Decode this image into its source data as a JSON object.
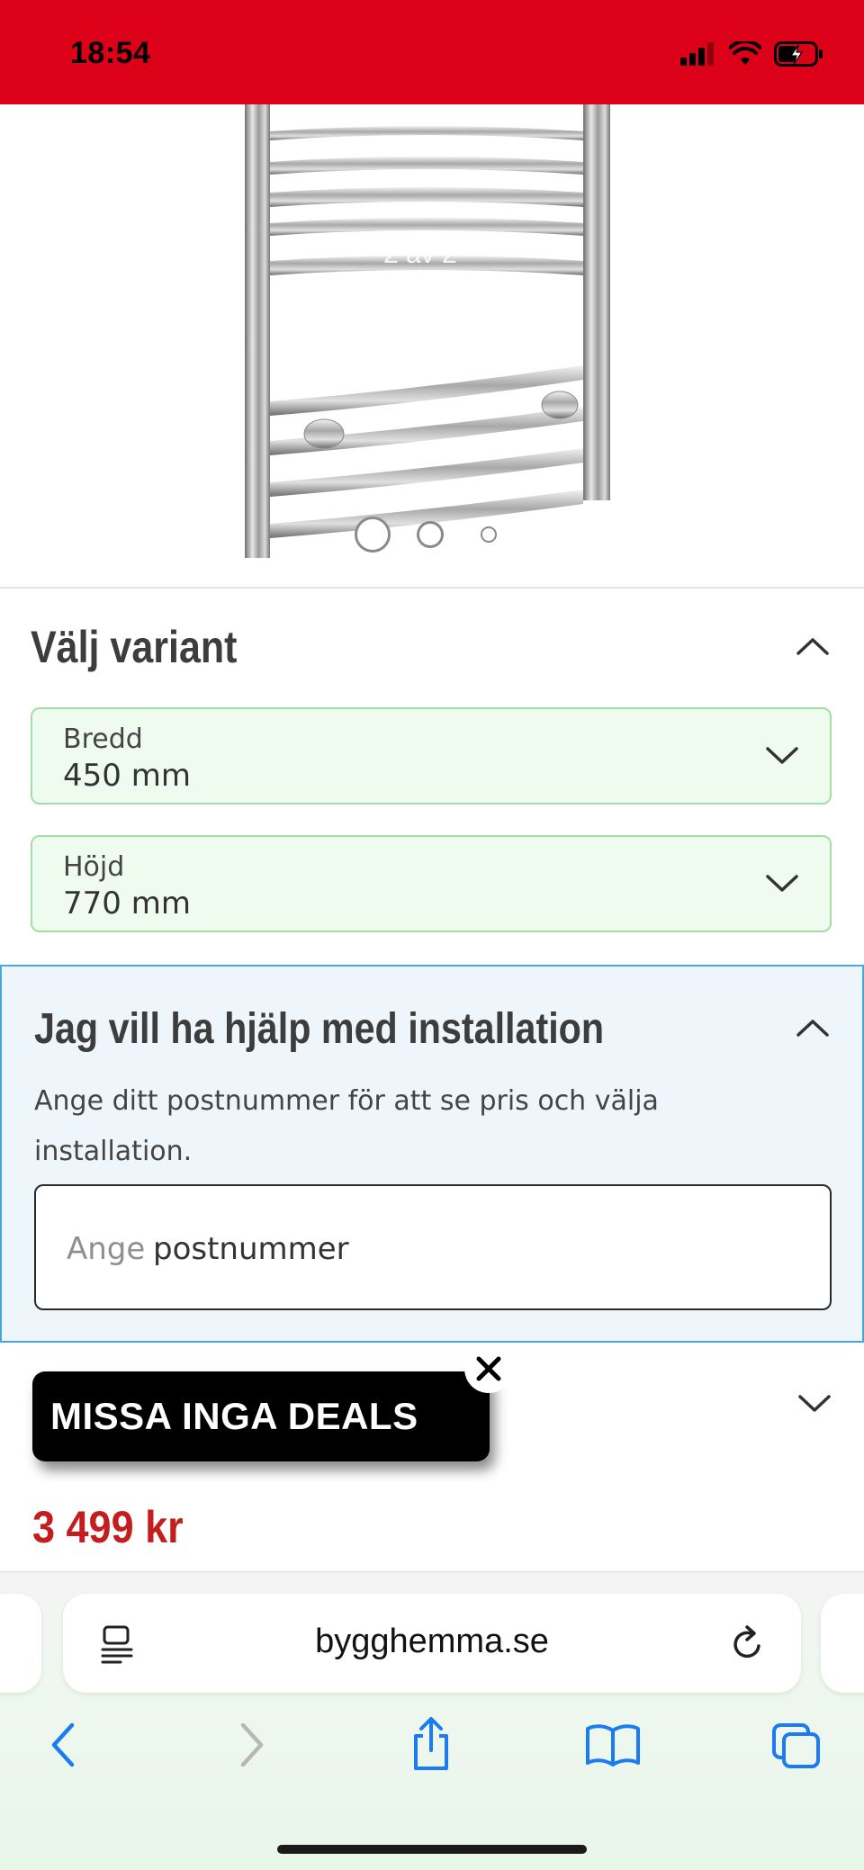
{
  "status_bar": {
    "time": "18:54"
  },
  "gallery": {
    "counter": "2 av 2"
  },
  "variant": {
    "title": "Välj variant",
    "width": {
      "label": "Bredd",
      "value": "450 mm"
    },
    "height": {
      "label": "Höjd",
      "value": "770 mm"
    }
  },
  "installation": {
    "title": "Jag vill ha hjälp med installation",
    "description": "Ange ditt postnummer för att se pris och välja installation.",
    "placeholder_part1": "Ange",
    "placeholder_part2": "postnummer"
  },
  "deals_popup": {
    "label": "MISSA INGA DEALS"
  },
  "price": "3 499 kr",
  "browser": {
    "url": "bygghemma.se"
  },
  "colors": {
    "brand_red": "#dc0018",
    "variant_green_bg": "#f0fbef",
    "install_blue": "#48a9d6",
    "price_red": "#c41d1d",
    "ios_blue": "#1a7cf0"
  }
}
